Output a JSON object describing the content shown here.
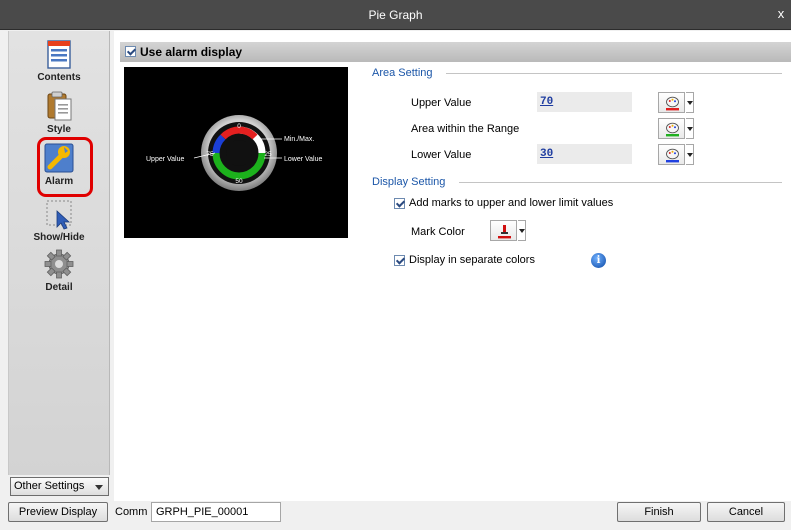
{
  "window": {
    "title": "Pie Graph",
    "close_glyph": "x"
  },
  "sidebar": {
    "items": [
      {
        "label": "Contents",
        "icon": "contents-icon"
      },
      {
        "label": "Style",
        "icon": "style-icon"
      },
      {
        "label": "Alarm",
        "icon": "alarm-wrench-icon",
        "selected": true
      },
      {
        "label": "Show/Hide",
        "icon": "show-hide-icon"
      },
      {
        "label": "Detail",
        "icon": "gear-icon"
      }
    ],
    "other_settings": "Other Settings"
  },
  "alarm": {
    "use_alarm_label": "Use alarm display",
    "use_alarm_checked": true,
    "preview": {
      "labels": {
        "top": "0",
        "right": "25",
        "bottom": "50",
        "left": "75",
        "min_max": "Min./Max.",
        "upper": "Upper Value",
        "lower": "Lower Value"
      }
    },
    "area_setting": {
      "title": "Area Setting",
      "upper_label": "Upper Value",
      "upper_value": "70",
      "within_label": "Area within the Range",
      "lower_label": "Lower Value",
      "lower_value": "30"
    },
    "display_setting": {
      "title": "Display Setting",
      "add_marks_label": "Add marks to upper and lower limit values",
      "add_marks_checked": true,
      "mark_color_label": "Mark Color",
      "separate_colors_label": "Display in separate colors",
      "separate_colors_checked": true
    }
  },
  "bottom": {
    "preview_display": "Preview Display",
    "comm_label": "Comm",
    "comm_value": "GRPH_PIE_00001",
    "finish": "Finish",
    "cancel": "Cancel"
  },
  "colors": {
    "alarm_highlight": "#e00000",
    "section_title": "#1b56a8",
    "value_link": "#1e3ca0",
    "upper_palette": "#e02020",
    "within_palette": "#20b020",
    "lower_palette": "#2040e0",
    "mark_color": "#d01010"
  }
}
